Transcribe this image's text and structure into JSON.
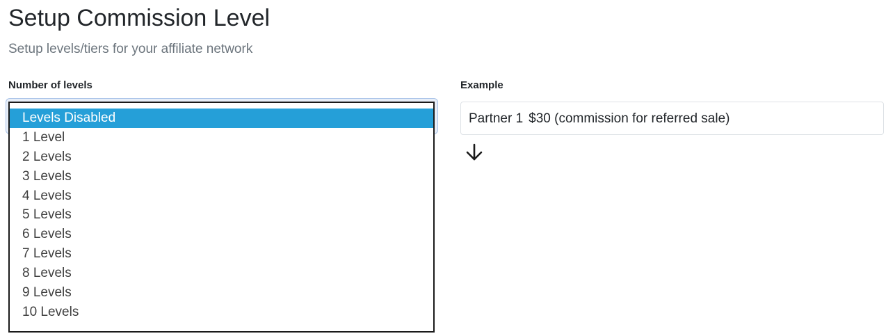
{
  "header": {
    "title": "Setup Commission Level",
    "subtitle": "Setup levels/tiers for your affiliate network"
  },
  "levels": {
    "label": "Number of levels",
    "selected": "Levels Disabled",
    "options": [
      "Levels Disabled",
      "1 Level",
      "2 Levels",
      "3 Levels",
      "4 Levels",
      "5 Levels",
      "6 Levels",
      "7 Levels",
      "8 Levels",
      "9 Levels",
      "10 Levels"
    ]
  },
  "example": {
    "label": "Example",
    "partner": "Partner 1",
    "amount": "$30 (commission for referred sale)",
    "arrow_icon": "arrow-down-icon"
  },
  "colors": {
    "selected_option_bg": "#259fd8",
    "subtitle": "#6c757d"
  }
}
